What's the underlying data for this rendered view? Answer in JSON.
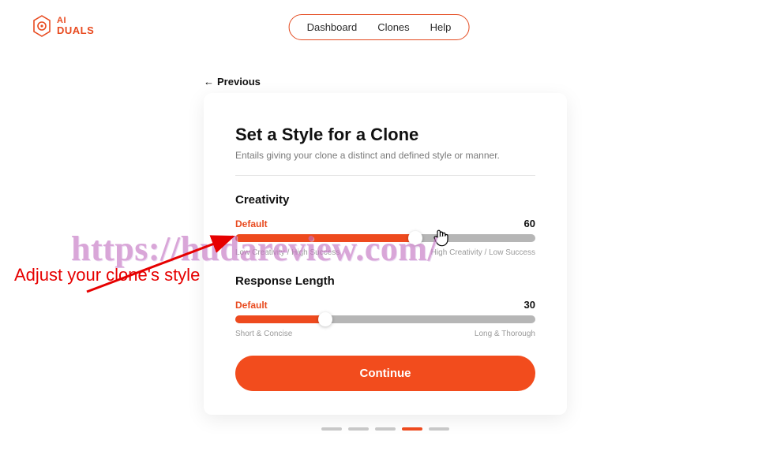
{
  "brand": {
    "line1": "AI",
    "line2": "DUALS"
  },
  "nav": {
    "dashboard": "Dashboard",
    "clones": "Clones",
    "help": "Help"
  },
  "back": {
    "arrow": "←",
    "label": "Previous"
  },
  "card": {
    "title": "Set a Style for a Clone",
    "subtitle": "Entails giving your clone a distinct and defined style or manner."
  },
  "creativity": {
    "section": "Creativity",
    "label": "Default",
    "value": "60",
    "percent": 60,
    "caption_left": "Low Creativity / High Success",
    "caption_right": "High Creativity / Low Success"
  },
  "response": {
    "section": "Response Length",
    "label": "Default",
    "value": "30",
    "percent": 30,
    "caption_left": "Short & Concise",
    "caption_right": "Long & Thorough"
  },
  "continue_label": "Continue",
  "stepper": {
    "total": 5,
    "active_index": 3
  },
  "watermark": "https://hudareview.com/",
  "annotation": "Adjust your clone's style"
}
